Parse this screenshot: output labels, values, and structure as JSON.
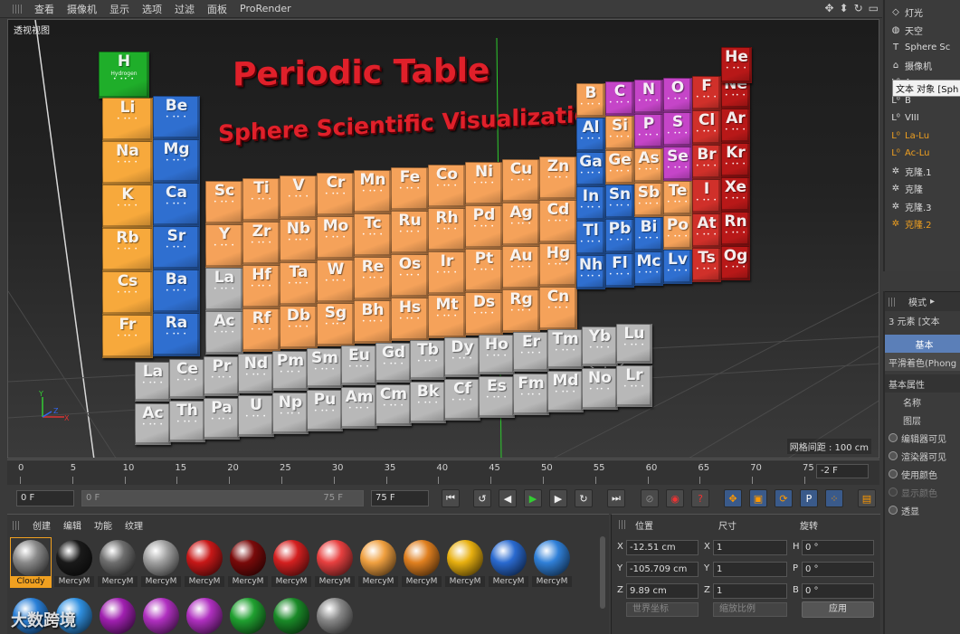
{
  "menu": [
    "查看",
    "摄像机",
    "显示",
    "选项",
    "过滤",
    "面板",
    "ProRender"
  ],
  "viewport": {
    "label": "透视视图",
    "grid_spacing": "网格间距 : 100 cm",
    "title": "Periodic Table",
    "subtitle": "Sphere Scientific Visualization",
    "axis_y": "Y",
    "axis_z": "Z",
    "axis_x": "X"
  },
  "elements": {
    "group1": [
      "H",
      "Li",
      "Na",
      "K",
      "Rb",
      "Cs",
      "Fr"
    ],
    "group2": [
      "Be",
      "Mg",
      "Ca",
      "Sr",
      "Ba",
      "Ra"
    ],
    "hydrogen_name": "Hydrogen",
    "transition_row1": [
      "Sc",
      "Ti",
      "V",
      "Cr",
      "Mn",
      "Fe",
      "Co",
      "Ni",
      "Cu",
      "Zn"
    ],
    "transition_row2": [
      "Y",
      "Zr",
      "Nb",
      "Mo",
      "Tc",
      "Ru",
      "Rh",
      "Pd",
      "Ag",
      "Cd"
    ],
    "transition_row3": [
      "La",
      "Hf",
      "Ta",
      "W",
      "Re",
      "Os",
      "Ir",
      "Pt",
      "Au",
      "Hg"
    ],
    "transition_row4": [
      "Ac",
      "Rf",
      "Db",
      "Sg",
      "Bh",
      "Hs",
      "Mt",
      "Ds",
      "Rg",
      "Cn"
    ],
    "pblock_row1": [
      "B",
      "C",
      "N",
      "O",
      "F",
      "Ne"
    ],
    "pblock_row2": [
      "Al",
      "Si",
      "P",
      "S",
      "Cl",
      "Ar"
    ],
    "pblock_row3": [
      "Ga",
      "Ge",
      "As",
      "Se",
      "Br",
      "Kr"
    ],
    "pblock_row4": [
      "In",
      "Sn",
      "Sb",
      "Te",
      "I",
      "Xe"
    ],
    "pblock_row5": [
      "Tl",
      "Pb",
      "Bi",
      "Po",
      "At",
      "Rn"
    ],
    "pblock_row6": [
      "Nh",
      "Fl",
      "Mc",
      "Lv",
      "Ts",
      "Og"
    ],
    "noble_top": "He",
    "lanthanides": [
      "La",
      "Ce",
      "Pr",
      "Nd",
      "Pm",
      "Sm",
      "Eu",
      "Gd",
      "Tb",
      "Dy",
      "Ho",
      "Er",
      "Tm",
      "Yb",
      "Lu"
    ],
    "actinides": [
      "Ac",
      "Th",
      "Pa",
      "U",
      "Np",
      "Pu",
      "Am",
      "Cm",
      "Bk",
      "Cf",
      "Es",
      "Fm",
      "Md",
      "No",
      "Lr"
    ]
  },
  "colors": {
    "alkali": "#f7a93c",
    "alkaline": "#2f6fd0",
    "transition": "#f5a25a",
    "metalloid_pink": "#c545c8",
    "halogen": "#d0302a",
    "noble": "#b81818",
    "gray": "#b8b8b8",
    "hydrogen": "#1fae2a",
    "accent": "#f0a020"
  },
  "timeline": {
    "ticks": [
      "0",
      "5",
      "10",
      "15",
      "20",
      "25",
      "30",
      "35",
      "40",
      "45",
      "50",
      "55",
      "60",
      "65",
      "70",
      "75"
    ],
    "frame": "-2 F"
  },
  "transport": {
    "start": "0 F",
    "range_start": "0 F",
    "range_end": "75 F",
    "end": "75 F"
  },
  "objects": [
    {
      "icon": "light-icon",
      "label": "灯光"
    },
    {
      "icon": "sky-icon",
      "label": "天空"
    },
    {
      "icon": "text-object-icon",
      "label": "Sphere Sc"
    },
    {
      "icon": "camera-icon",
      "label": "摄像机"
    },
    {
      "icon": "null-icon",
      "label": "A"
    },
    {
      "icon": "null-icon",
      "label": "B"
    },
    {
      "icon": "null-icon",
      "label": "VIII"
    },
    {
      "icon": "null-icon",
      "label": "La-Lu"
    },
    {
      "icon": "null-icon",
      "label": "Ac-Lu"
    },
    {
      "icon": "cloner-icon",
      "label": "克隆.1"
    },
    {
      "icon": "cloner-icon",
      "label": "克隆"
    },
    {
      "icon": "cloner-icon",
      "label": "克隆.3"
    },
    {
      "icon": "cloner-icon",
      "label": "克隆.2"
    }
  ],
  "tooltip": "文本 对象 [Sph",
  "attributes": {
    "mode": "模式",
    "selection": "3 元素 [文本",
    "tab_basic": "基本",
    "tab_phong": "平滑着色(Phong",
    "section": "基本属性",
    "name": "名称",
    "layer": "图层",
    "editor_visible": "编辑器可见",
    "render_visible": "渲染器可见",
    "use_color": "使用颜色",
    "display_color": "显示颜色",
    "transparency": "透显"
  },
  "materials": {
    "menu": [
      "创建",
      "编辑",
      "功能",
      "纹理"
    ],
    "items": [
      {
        "label": "Cloudy",
        "color": "#8a8a8a"
      },
      {
        "label": "MercyM",
        "color": "#1a1a1a"
      },
      {
        "label": "MercyM",
        "color": "#6e6e6e"
      },
      {
        "label": "MercyM",
        "color": "#a0a0a0"
      },
      {
        "label": "MercyM",
        "color": "#c81818"
      },
      {
        "label": "MercyM",
        "color": "#7a0a0a"
      },
      {
        "label": "MercyM",
        "color": "#d42020"
      },
      {
        "label": "MercyM",
        "color": "#e84040"
      },
      {
        "label": "MercyM",
        "color": "#f0a040"
      },
      {
        "label": "MercyM",
        "color": "#e08020"
      },
      {
        "label": "MercyM",
        "color": "#e8b010"
      },
      {
        "label": "MercyM",
        "color": "#2a6ad0"
      },
      {
        "label": "MercyM",
        "color": "#3080d8"
      }
    ],
    "row2_colors": [
      "#2a80d8",
      "#3090e0",
      "#a020b0",
      "#b030c0",
      "#b030c0",
      "#20a030",
      "#1a8a28",
      "#888888"
    ]
  },
  "coords": {
    "h_position": "位置",
    "h_size": "尺寸",
    "h_rotation": "旋转",
    "x_pos": "-12.51 cm",
    "y_pos": "-105.709 cm",
    "z_pos": "9.89 cm",
    "x_size": "1",
    "y_size": "1",
    "z_size": "1",
    "h_rot": "0 °",
    "p_rot": "0 °",
    "b_rot": "0 °",
    "lbl_x": "X",
    "lbl_y": "Y",
    "lbl_z": "Z",
    "lbl_h": "H",
    "lbl_p": "P",
    "lbl_b": "B",
    "world": "世界坐标",
    "scale": "缩放比例",
    "apply": "应用"
  },
  "watermark": "大数跨境"
}
